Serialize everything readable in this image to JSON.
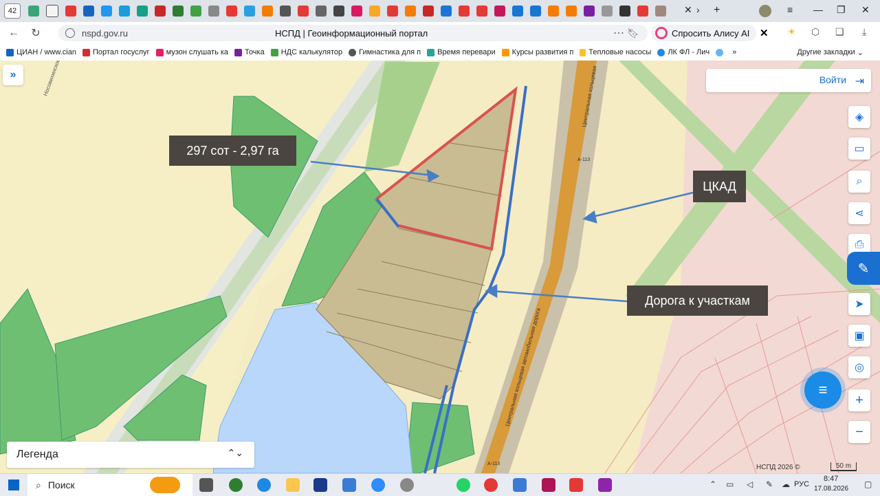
{
  "browser": {
    "tab_count": "42",
    "address": "nspd.gov.ru",
    "page_title": "НСПД | Геоинформационный портал",
    "alice_label": "Спросить Алису AI",
    "bookmarks": [
      "ЦИАН / www.cian",
      "Портал госуслуг",
      "музон слушать ка",
      "Точка",
      "НДС калькулятор",
      "Гимнастика для п",
      "Время перевари",
      "Курсы развития п",
      "Тепловые насосы",
      "ЛК ФЛ - Лич"
    ],
    "other_bookmarks": "Другие закладки"
  },
  "map": {
    "login_label": "Войти",
    "legend_label": "Легенда",
    "annotations": {
      "area": "297 сот - 2,97 га",
      "ring_road": "ЦКАД",
      "access_road": "Дорога к участкам"
    },
    "road_labels": {
      "ring_upper": "Центральная кольцевая",
      "ring_lower": "Центральная кольцевая автомобильная дорога",
      "route_a113_upper": "А-113",
      "route_a113_lower": "А-113",
      "street": "Носовихинское"
    },
    "attribution": "НСПД 2026 ©",
    "scale": "50 m",
    "colors": {
      "parcel_outline": "#d9534f",
      "road_line": "#3a6fc6",
      "forest": "#6fbf73",
      "water": "#b9d7fb",
      "ring_road": "#d99a3a"
    }
  },
  "taskbar": {
    "search_label": "Поиск",
    "language": "РУС",
    "time": "8:47",
    "date": "17.08.2026"
  }
}
